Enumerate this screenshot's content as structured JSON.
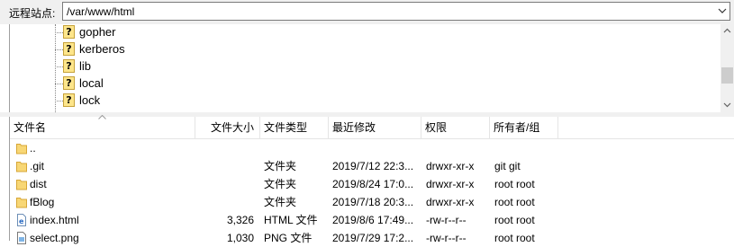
{
  "site_bar": {
    "label": "远程站点:",
    "path": "/var/www/html"
  },
  "tree": {
    "items": [
      {
        "label": "gopher",
        "icon": "unknown-folder-icon"
      },
      {
        "label": "kerberos",
        "icon": "unknown-folder-icon"
      },
      {
        "label": "lib",
        "icon": "unknown-folder-icon"
      },
      {
        "label": "local",
        "icon": "unknown-folder-icon"
      },
      {
        "label": "lock",
        "icon": "unknown-folder-icon"
      }
    ]
  },
  "list": {
    "columns": [
      "文件名",
      "文件大小",
      "文件类型",
      "最近修改",
      "权限",
      "所有者/组"
    ],
    "rows": [
      {
        "icon": "folder-icon",
        "name": "..",
        "size": "",
        "type": "",
        "modified": "",
        "perms": "",
        "owner": ""
      },
      {
        "icon": "folder-icon",
        "name": ".git",
        "size": "",
        "type": "文件夹",
        "modified": "2019/7/12 22:3...",
        "perms": "drwxr-xr-x",
        "owner": "git git"
      },
      {
        "icon": "folder-icon",
        "name": "dist",
        "size": "",
        "type": "文件夹",
        "modified": "2019/8/24 17:0...",
        "perms": "drwxr-xr-x",
        "owner": "root root"
      },
      {
        "icon": "folder-icon",
        "name": "fBlog",
        "size": "",
        "type": "文件夹",
        "modified": "2019/7/18 20:3...",
        "perms": "drwxr-xr-x",
        "owner": "root root"
      },
      {
        "icon": "html-file-icon",
        "name": "index.html",
        "size": "3,326",
        "type": "HTML 文件",
        "modified": "2019/8/6 17:49...",
        "perms": "-rw-r--r--",
        "owner": "root root"
      },
      {
        "icon": "image-file-icon",
        "name": "select.png",
        "size": "1,030",
        "type": "PNG 文件",
        "modified": "2019/7/29 17:2...",
        "perms": "-rw-r--r--",
        "owner": "root root"
      }
    ]
  },
  "colors": {
    "folder": "#f8d775",
    "chrome": "#f0f0f0",
    "border": "#a0a0a0"
  }
}
